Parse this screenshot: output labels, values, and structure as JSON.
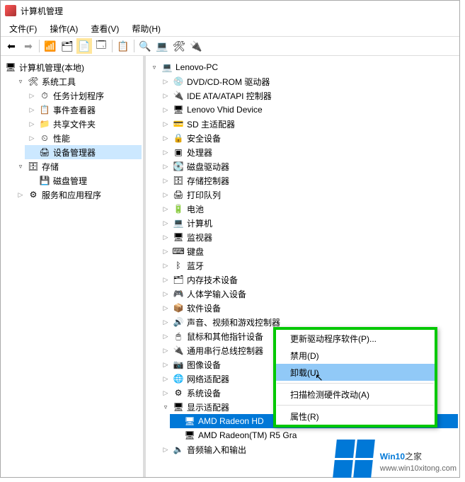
{
  "title": "计算机管理",
  "menubar": {
    "file": "文件(F)",
    "action": "操作(A)",
    "view": "查看(V)",
    "help": "帮助(H)"
  },
  "left_tree": {
    "root": "计算机管理(本地)",
    "system_tools": "系统工具",
    "task_scheduler": "任务计划程序",
    "event_viewer": "事件查看器",
    "shared_folders": "共享文件夹",
    "performance": "性能",
    "device_manager": "设备管理器",
    "storage": "存储",
    "disk_management": "磁盘管理",
    "services": "服务和应用程序"
  },
  "right_tree": {
    "root": "Lenovo-PC",
    "dvd": "DVD/CD-ROM 驱动器",
    "ide": "IDE ATA/ATAPI 控制器",
    "vhid": "Lenovo Vhid Device",
    "sd": "SD 主适配器",
    "security": "安全设备",
    "processors": "处理器",
    "disk_drives": "磁盘驱动器",
    "storage_ctrl": "存储控制器",
    "print_queues": "打印队列",
    "batteries": "电池",
    "computer": "计算机",
    "monitors": "监视器",
    "keyboards": "键盘",
    "bluetooth": "蓝牙",
    "memory": "内存技术设备",
    "hid": "人体学输入设备",
    "software": "软件设备",
    "sound": "声音、视频和游戏控制器",
    "mouse": "鼠标和其他指针设备",
    "usb": "通用串行总线控制器",
    "imaging": "图像设备",
    "network": "网络适配器",
    "system": "系统设备",
    "display": "显示适配器",
    "gpu1": "AMD Radeon HD",
    "gpu2": "AMD Radeon(TM) R5 Gra",
    "audio": "音频输入和输出"
  },
  "context_menu": {
    "update": "更新驱动程序软件(P)...",
    "disable": "禁用(D)",
    "uninstall": "卸载(U)",
    "scan": "扫描检测硬件改动(A)",
    "props": "属性(R)"
  },
  "watermark": {
    "brand_a": "Win10",
    "brand_b": "之家",
    "url": "www.win10xitong.com"
  }
}
